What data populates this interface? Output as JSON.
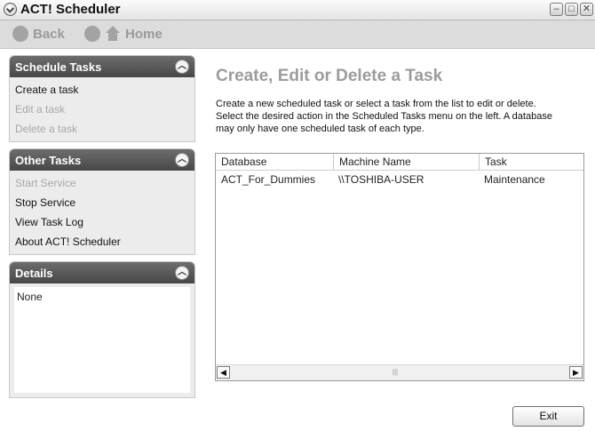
{
  "window": {
    "title": "ACT! Scheduler",
    "controls": [
      "minimize",
      "maximize",
      "close"
    ]
  },
  "nav": {
    "back_label": "Back",
    "home_label": "Home"
  },
  "sidebar": {
    "schedule_tasks": {
      "title": "Schedule Tasks",
      "items": [
        {
          "label": "Create a task",
          "enabled": true
        },
        {
          "label": "Edit a task",
          "enabled": false
        },
        {
          "label": "Delete a task",
          "enabled": false
        }
      ]
    },
    "other_tasks": {
      "title": "Other Tasks",
      "items": [
        {
          "label": "Start Service",
          "enabled": false
        },
        {
          "label": "Stop Service",
          "enabled": true
        },
        {
          "label": "View Task Log",
          "enabled": true
        },
        {
          "label": "About ACT! Scheduler",
          "enabled": true
        }
      ]
    },
    "details": {
      "title": "Details",
      "content": "None"
    }
  },
  "main": {
    "title": "Create, Edit or Delete a Task",
    "description_lines": [
      "Create a new scheduled task or select a task from the list to edit or delete.",
      "Select the desired action in the Scheduled Tasks menu on the left. A database",
      "may only have one scheduled task of each type."
    ],
    "list": {
      "columns": [
        "Database",
        "Machine Name",
        "Task"
      ],
      "rows": [
        [
          "ACT_For_Dummies",
          "\\\\TOSHIBA-USER",
          "Maintenance"
        ]
      ]
    },
    "exit_label": "Exit"
  },
  "icons": {
    "app": "scheduler-clock-icon",
    "collapse": "chevron-up-circle-icon",
    "back": "back-arrow-icon",
    "home": "home-icon"
  }
}
